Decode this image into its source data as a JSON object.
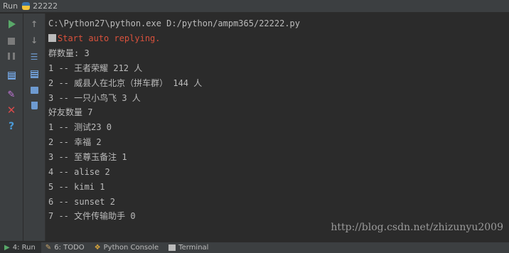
{
  "title_bar": {
    "run_label": "Run",
    "config_name": "22222"
  },
  "toolbar": {
    "rerun_icon": "play-icon",
    "stop_icon": "stop-icon",
    "pause_icon": "pause-icon",
    "up_icon": "arrow-up-icon",
    "down_icon": "arrow-down-icon"
  },
  "console": {
    "command": "C:\\Python27\\python.exe D:/python/ampm365/22222.py",
    "error_line": "Start auto replying.",
    "lines": [
      "群数量: 3",
      "1 -- 王者荣耀 212 人",
      "2 -- 威县人在北京（拼车群） 144 人",
      "3 -- 一只小鸟飞 3 人",
      "好友数量 7",
      "1 -- 测试23 0",
      "2 -- 幸福 2",
      "3 -- 至尊玉备注 1",
      "4 -- alise 2",
      "5 -- kimi 1",
      "6 -- sunset 2",
      "7 -- 文件传输助手 0"
    ],
    "watermark": "http://blog.csdn.net/zhizunyu2009"
  },
  "bottom_tabs": [
    {
      "label": "4: Run"
    },
    {
      "label": "6: TODO"
    },
    {
      "label": "Python Console"
    },
    {
      "label": "Terminal"
    }
  ],
  "colors": {
    "background": "#2b2b2b",
    "panel": "#3c3f41",
    "text": "#bbbbbb",
    "error": "#d9513c",
    "run_green": "#59a869"
  }
}
